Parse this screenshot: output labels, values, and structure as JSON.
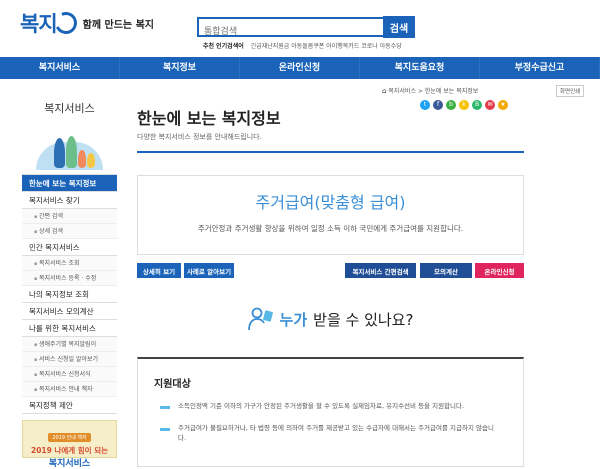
{
  "header": {
    "logo_text": "복지",
    "slogan": "함께 만드는 복지",
    "search_placeholder": "통합검색",
    "search_button": "검색",
    "popular_label": "추천 인기검색어",
    "popular_terms": "긴급재난지원금  아동돌봄쿠폰  아이행복카드  코로나  아동수당"
  },
  "nav": {
    "items": [
      "복지서비스",
      "복지정보",
      "온라인신청",
      "복지도움요청",
      "부정수급신고"
    ]
  },
  "sidebar": {
    "title": "복지서비스",
    "menu": [
      {
        "label": "한눈에 보는 복지정보",
        "type": "main",
        "active": true
      },
      {
        "label": "복지서비스 찾기",
        "type": "main"
      },
      {
        "label": "간편 검색",
        "type": "sub"
      },
      {
        "label": "상세 검색",
        "type": "sub"
      },
      {
        "label": "민간 복지서비스",
        "type": "main"
      },
      {
        "label": "복지서비스 조회",
        "type": "sub"
      },
      {
        "label": "복지서비스 등록 · 수정",
        "type": "sub"
      },
      {
        "label": "나의 복지정보 조회",
        "type": "main"
      },
      {
        "label": "복지서비스 모의계산",
        "type": "main"
      },
      {
        "label": "나를 위한 복지서비스",
        "type": "main"
      },
      {
        "label": "생애주기별 복지알림이",
        "type": "sub"
      },
      {
        "label": "서비스 신청일 알아보기",
        "type": "sub"
      },
      {
        "label": "복지서비스 신청서식",
        "type": "sub"
      },
      {
        "label": "복지서비스 안내 책자",
        "type": "sub"
      },
      {
        "label": "복지정책 제안",
        "type": "main"
      }
    ],
    "banner": {
      "tag": "2019 안내 책자",
      "line1": "2019 나에게 힘이 되는",
      "line2": "복지서비스"
    }
  },
  "breadcrumb": {
    "items": "복지서비스  >  한눈에 보는 복지정보",
    "print": "화면인쇄"
  },
  "page": {
    "title": "한눈에 보는 복지정보",
    "description": "다양한 복지서비스 정보를 안내해드립니다."
  },
  "sns_icons": [
    {
      "name": "twitter-icon",
      "glyph": "t",
      "color": "#1da1f2"
    },
    {
      "name": "facebook-icon",
      "glyph": "f",
      "color": "#3b5998"
    },
    {
      "name": "blog-icon",
      "glyph": "b",
      "color": "#3bb143"
    },
    {
      "name": "kakao-icon",
      "glyph": "k",
      "color": "#f6c200"
    },
    {
      "name": "band-icon",
      "glyph": "B",
      "color": "#29b76a"
    },
    {
      "name": "mail-icon",
      "glyph": "✉",
      "color": "#e23d4c"
    },
    {
      "name": "star-icon",
      "glyph": "★",
      "color": "#f2a900"
    }
  ],
  "service": {
    "title": "주거급여(맞춤형 급여)",
    "description": "주거안정과 주거생활 향상을 위하여 일정 소득 이하 국민에게 주거급여를 지원합니다."
  },
  "buttons": {
    "detail": "상세히 보기",
    "cases": "사례로 알아보기",
    "simple_search": "복지서비스 간편검색",
    "calc": "모의계산",
    "apply": "온라인신청"
  },
  "question": {
    "highlight": "누가",
    "rest": "받을 수 있나요?"
  },
  "criteria": {
    "title": "지원대상",
    "items": [
      "소득인정액 기준 이하의 가구가 안정된 주거생활을 할 수 있도록 실제임차료, 유지수선비 등을 지원합니다.",
      "주거급여가 불필요하거나, 타 법령 등에 의하여 주거를 제공받고 있는 수급자에 대해서는 주거급여를 지급하지 않습니다."
    ]
  },
  "colors": {
    "brand": "#1a63b8",
    "accent": "#3a8fd6",
    "apply": "#e0245e",
    "dark_btn": "#1f4e96"
  }
}
